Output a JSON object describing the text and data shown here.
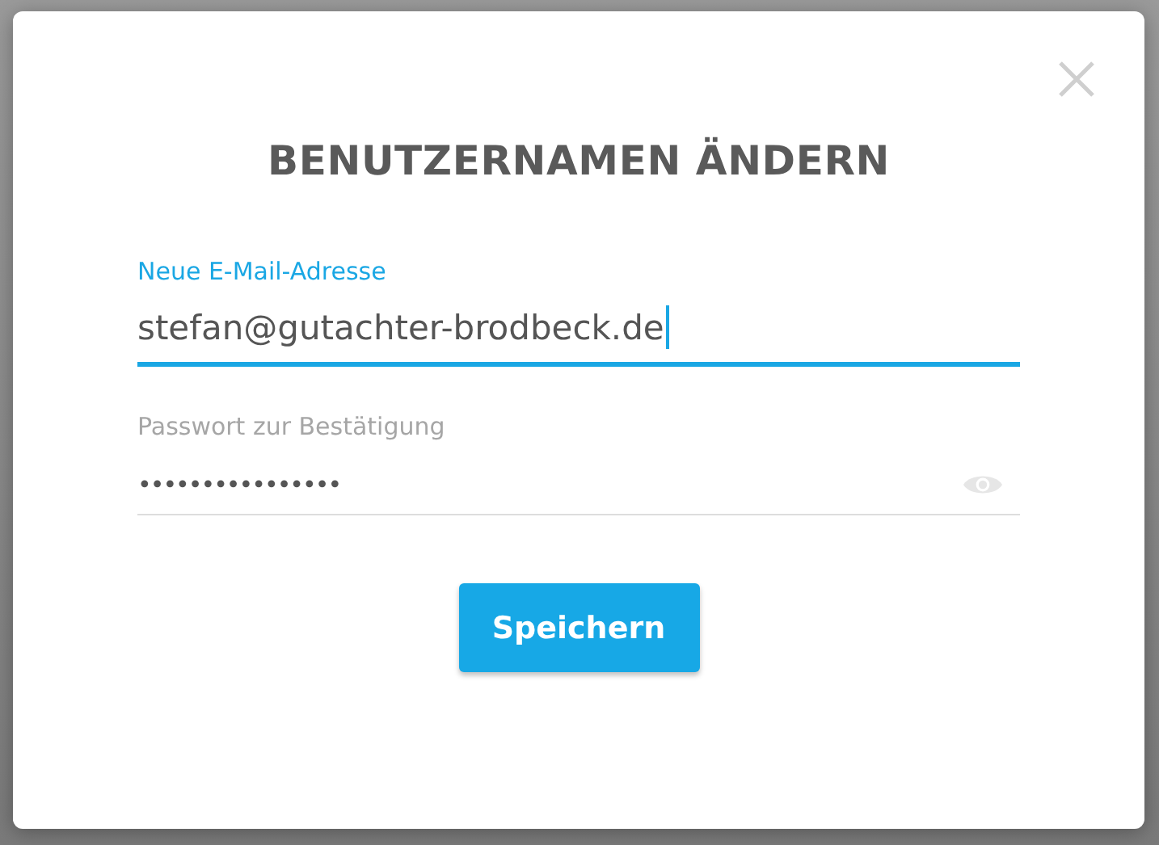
{
  "dialog": {
    "title": "BENUTZERNAMEN ÄNDERN",
    "fields": [
      {
        "kind": "text",
        "label": "Neue E-Mail-Adresse",
        "value": "stefan@gutachter-brodbeck.de",
        "focused": true
      },
      {
        "kind": "password",
        "label": "Passwort zur Bestätigung",
        "value": "••••••••••••••••",
        "focused": false
      }
    ],
    "button": "Speichern"
  }
}
